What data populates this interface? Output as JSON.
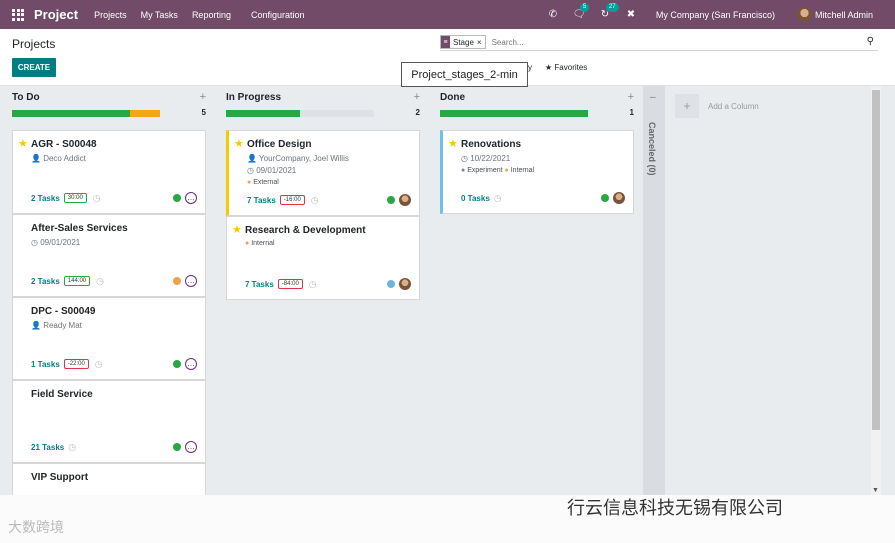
{
  "navbar": {
    "app_name": "Project",
    "menu": [
      "Projects",
      "My Tasks",
      "Reporting",
      "Configuration"
    ],
    "chat_badge": "5",
    "activity_badge": "27",
    "company": "My Company (San Francisco)",
    "user": "Mitchell Admin"
  },
  "control": {
    "title": "Projects",
    "create_label": "CREATE",
    "facet_label": "Stage",
    "search_placeholder": "Search...",
    "filter_tail": "y",
    "favorites_label": "Favorites",
    "tooltip": "Project_stages_2-min"
  },
  "columns": [
    {
      "title": "To Do",
      "count": "5",
      "progress_green": 0.7,
      "progress_orange": 0.16,
      "cards": [
        {
          "title": "AGR - S00048",
          "starred": true,
          "customer": "Deco Addict",
          "tasks": "2 Tasks",
          "hours": "30:00",
          "hours_state": "ok",
          "status_color": "#28a745"
        },
        {
          "title": "After-Sales Services",
          "starred": false,
          "date": "09/01/2021",
          "tasks": "2 Tasks",
          "hours": "144:00",
          "hours_state": "ok",
          "status_color": "#f0a24b"
        },
        {
          "title": "DPC - S00049",
          "starred": false,
          "customer": "Ready Mat",
          "tasks": "1 Tasks",
          "hours": "-22:00",
          "hours_state": "bad",
          "status_color": "#28a745"
        },
        {
          "title": "Field Service",
          "starred": false,
          "tasks": "21 Tasks",
          "status_color": "#28a745"
        },
        {
          "title": "VIP Support",
          "starred": false
        }
      ]
    },
    {
      "title": "In Progress",
      "count": "2",
      "progress_green": 0.5,
      "cards": [
        {
          "title": "Office Design",
          "starred": true,
          "customer": "YourCompany, Joel Willis",
          "date": "09/01/2021",
          "tags": [
            "External"
          ],
          "tasks": "7 Tasks",
          "hours": "-16:00",
          "hours_state": "bad",
          "status_color": "#28a745"
        },
        {
          "title": "Research & Development",
          "starred": true,
          "tags": [
            "Internal"
          ],
          "tasks": "7 Tasks",
          "hours": "-84:00",
          "hours_state": "bad",
          "status_color": "#6cb4e0"
        }
      ]
    },
    {
      "title": "Done",
      "count": "1",
      "progress_green": 1.0,
      "cards": [
        {
          "title": "Renovations",
          "starred": true,
          "date": "10/22/2021",
          "tags": [
            "Experiment",
            "Internal"
          ],
          "tasks": "0 Tasks",
          "status_color": "#28a745"
        }
      ]
    }
  ],
  "folded_column": "Canceled (0)",
  "add_column_label": "Add a Column",
  "watermarks": {
    "left": "大数跨境",
    "right": "行云信息科技无锡有限公司"
  },
  "colors": {
    "brand": "#714b67",
    "primary": "#017e84",
    "green": "#28a745",
    "orange": "#f0a24b",
    "star": "#f3cc00"
  },
  "icons": [
    "apps-grid-icon",
    "phone-icon",
    "chat-icon",
    "activity-icon",
    "tools-icon",
    "search-icon",
    "star-icon",
    "person-icon",
    "clock-icon",
    "plus-icon"
  ]
}
